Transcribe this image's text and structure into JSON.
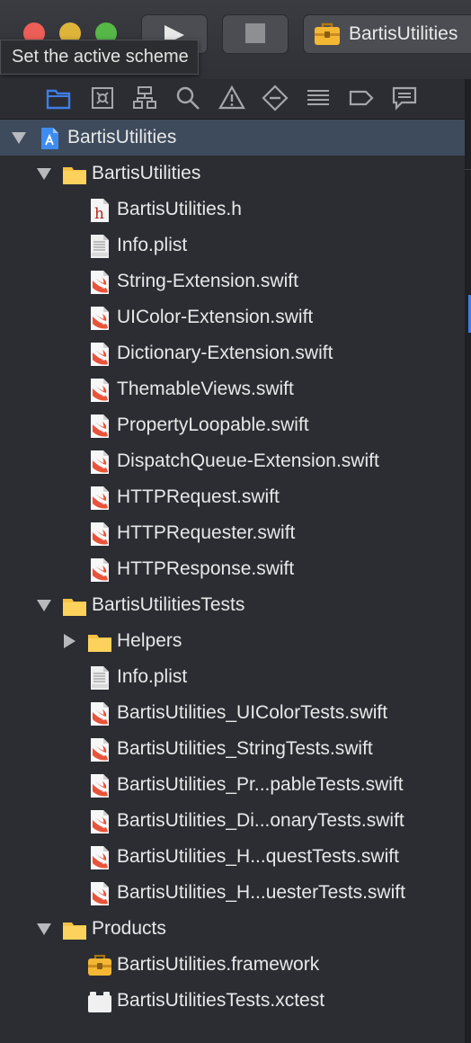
{
  "toolbar": {
    "scheme_label": "BartisUtilities",
    "tooltip": "Set the active scheme"
  },
  "navigator_tabs": [
    {
      "name": "project-navigator-icon",
      "selected": true
    },
    {
      "name": "source-control-navigator-icon",
      "selected": false
    },
    {
      "name": "symbol-navigator-icon",
      "selected": false
    },
    {
      "name": "find-navigator-icon",
      "selected": false
    },
    {
      "name": "issue-navigator-icon",
      "selected": false
    },
    {
      "name": "test-navigator-icon",
      "selected": false
    },
    {
      "name": "debug-navigator-icon",
      "selected": false
    },
    {
      "name": "breakpoint-navigator-icon",
      "selected": false
    },
    {
      "name": "report-navigator-icon",
      "selected": false
    }
  ],
  "tree": [
    {
      "label": "BartisUtilities",
      "kind": "project",
      "depth": 0,
      "disclosure": "open"
    },
    {
      "label": "BartisUtilities",
      "kind": "folder",
      "depth": 1,
      "disclosure": "open"
    },
    {
      "label": "BartisUtilities.h",
      "kind": "header",
      "depth": 2
    },
    {
      "label": "Info.plist",
      "kind": "plist",
      "depth": 2
    },
    {
      "label": "String-Extension.swift",
      "kind": "swift",
      "depth": 2
    },
    {
      "label": "UIColor-Extension.swift",
      "kind": "swift",
      "depth": 2
    },
    {
      "label": "Dictionary-Extension.swift",
      "kind": "swift",
      "depth": 2
    },
    {
      "label": "ThemableViews.swift",
      "kind": "swift",
      "depth": 2
    },
    {
      "label": "PropertyLoopable.swift",
      "kind": "swift",
      "depth": 2
    },
    {
      "label": "DispatchQueue-Extension.swift",
      "kind": "swift",
      "depth": 2
    },
    {
      "label": "HTTPRequest.swift",
      "kind": "swift",
      "depth": 2
    },
    {
      "label": "HTTPRequester.swift",
      "kind": "swift",
      "depth": 2
    },
    {
      "label": "HTTPResponse.swift",
      "kind": "swift",
      "depth": 2
    },
    {
      "label": "BartisUtilitiesTests",
      "kind": "folder",
      "depth": 1,
      "disclosure": "open"
    },
    {
      "label": "Helpers",
      "kind": "folder",
      "depth": 2,
      "disclosure": "closed"
    },
    {
      "label": "Info.plist",
      "kind": "plist",
      "depth": 2
    },
    {
      "label": "BartisUtilities_UIColorTests.swift",
      "kind": "swift",
      "depth": 2
    },
    {
      "label": "BartisUtilities_StringTests.swift",
      "kind": "swift",
      "depth": 2
    },
    {
      "label": "BartisUtilities_Pr...pableTests.swift",
      "kind": "swift",
      "depth": 2
    },
    {
      "label": "BartisUtilities_Di...onaryTests.swift",
      "kind": "swift",
      "depth": 2
    },
    {
      "label": "BartisUtilities_H...questTests.swift",
      "kind": "swift",
      "depth": 2
    },
    {
      "label": "BartisUtilities_H...uesterTests.swift",
      "kind": "swift",
      "depth": 2
    },
    {
      "label": "Products",
      "kind": "folder",
      "depth": 1,
      "disclosure": "open"
    },
    {
      "label": "BartisUtilities.framework",
      "kind": "framework",
      "depth": 2
    },
    {
      "label": "BartisUtilitiesTests.xctest",
      "kind": "xctest",
      "depth": 2
    }
  ],
  "colors": {
    "background": "#2b2d33",
    "selection": "#3e4b5c",
    "accent": "#3f7ee8",
    "folder": "#f6c244",
    "swift": "#e9533a"
  }
}
